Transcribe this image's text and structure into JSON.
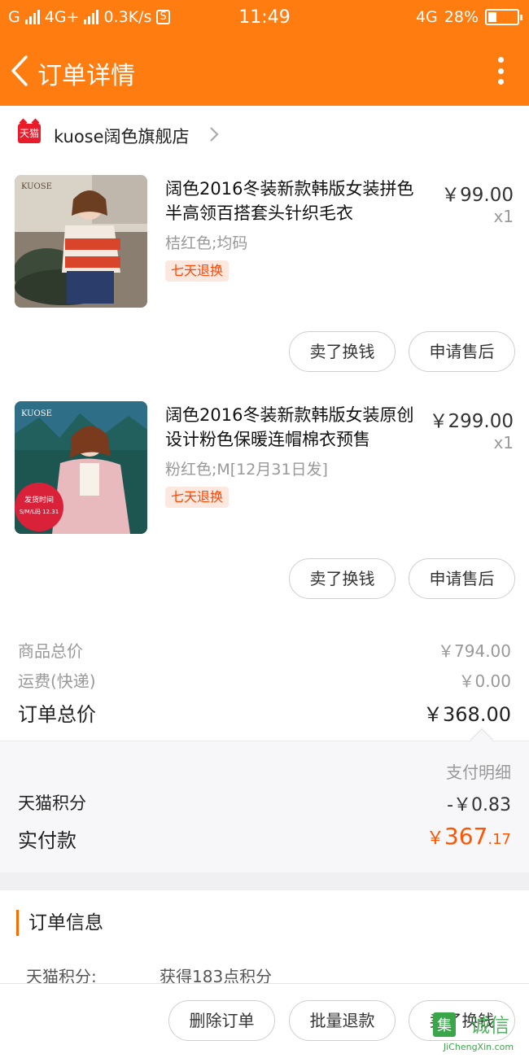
{
  "status_bar": {
    "carrier1": "G",
    "carrier2": "4G+",
    "speed": "0.3K/s",
    "sim_badge": "S",
    "time": "11:49",
    "network": "4G",
    "battery": "28%",
    "battery_level": 0.28
  },
  "header": {
    "title": "订单详情",
    "back_icon": "chevron-left-icon",
    "more_icon": "more-vertical-icon",
    "accent_color": "#ff7c10"
  },
  "store": {
    "badge": "天猫",
    "name": "kuose阔色旗舰店"
  },
  "items": [
    {
      "title": "阔色2016冬装新款韩版女装拼色半高领百搭套头针织毛衣",
      "price": "￥99.00",
      "qty": "x1",
      "sku": "桔红色;均码",
      "tag": "七天退换",
      "thumb_brand": "KUOSE",
      "btn_sell": "卖了换钱",
      "btn_after_sale": "申请售后"
    },
    {
      "title": "阔色2016冬装新款韩版女装原创设计粉色保暖连帽棉衣预售",
      "price": "￥299.00",
      "qty": "x1",
      "sku": "粉红色;M[12月31日发]",
      "tag": "七天退换",
      "thumb_brand": "KUOSE",
      "thumb_sticker_title": "发货时间",
      "thumb_sticker_text": "S/M/L码 12.31",
      "btn_sell": "卖了换钱",
      "btn_after_sale": "申请售后"
    }
  ],
  "summary": {
    "goods_total_label": "商品总价",
    "goods_total": "￥794.00",
    "shipping_label": "运费(快递)",
    "shipping": "￥0.00",
    "order_total_label": "订单总价",
    "order_total": "￥368.00"
  },
  "payment": {
    "detail_label": "支付明细",
    "points_label": "天猫积分",
    "points_value": "-￥0.83",
    "paid_label": "实付款",
    "paid_currency": "￥",
    "paid_int": "367",
    "paid_dec": ".17",
    "paid_color": "#ff5500"
  },
  "order_info": {
    "section_title": "订单信息",
    "points_key": "天猫积分:",
    "points_val": "获得183点积分"
  },
  "bottom_bar": {
    "delete": "删除订单",
    "batch_refund": "批量退款",
    "sell": "卖了换钱"
  },
  "watermark": {
    "logo_char": "集",
    "cn": "诚信",
    "url": "JiChengXin.com"
  }
}
